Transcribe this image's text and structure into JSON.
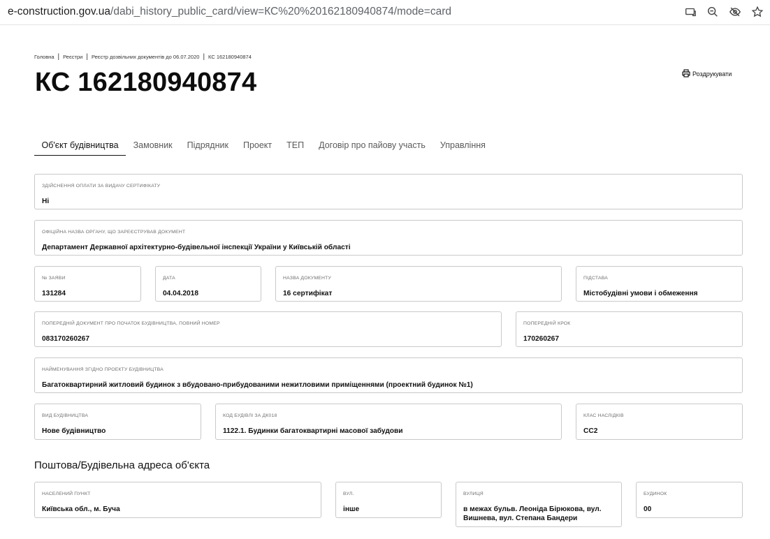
{
  "browser": {
    "url_host": "e-construction.gov.ua",
    "url_path": "/dabi_history_public_card/view=КС%20%20162180940874/mode=card",
    "icons": [
      "cast-icon",
      "zoom-icon",
      "eye-off-icon",
      "star-icon"
    ]
  },
  "breadcrumb": [
    "Головна",
    "Реєстри",
    "Реєстр дозвільних документів до 06.07.2020",
    "КС 162180940874"
  ],
  "title": "КС 162180940874",
  "print_label": "Роздрукувати",
  "tabs": [
    "Об'єкт будівництва",
    "Замовник",
    "Підрядник",
    "Проект",
    "ТЕП",
    "Договір про пайову участь",
    "Управління"
  ],
  "fields": {
    "payment": {
      "label": "Здійснення оплати за видачу сертифікату",
      "value": "Ні"
    },
    "authority": {
      "label": "Офіційна назва органу, що зареєстрував документ",
      "value": "Департамент Державної архітектурно-будівельної інспекції України у Київській області"
    },
    "app_no": {
      "label": "№ заяви",
      "value": "131284"
    },
    "date": {
      "label": "Дата",
      "value": "04.04.2018"
    },
    "doc_name": {
      "label": "Назва документу",
      "value": "16 сертифікат"
    },
    "basis": {
      "label": "Підстава",
      "value": "Містобудівні умови і обмеження"
    },
    "prev_doc": {
      "label": "Попередній документ про початок будівництва, повний номер",
      "value": "083170260267"
    },
    "prev_step": {
      "label": "Попередній крок",
      "value": "170260267"
    },
    "project_name": {
      "label": "Найменування згідно проекту будівництва",
      "value": "Багатоквартирний житловий будинок з вбудовано-прибудованими нежитловими приміщеннями (проектний будинок №1)"
    },
    "build_type": {
      "label": "Вид будівництва",
      "value": "Нове будівництво"
    },
    "building_code": {
      "label": "Код будівлі за ДК018",
      "value": "1122.1. Будинки багатоквартирні масової забудови"
    },
    "consequence_class": {
      "label": "Клас наслідків",
      "value": "СС2"
    }
  },
  "address_title": "Поштова/Будівельна адреса об'єкта",
  "address": {
    "locality": {
      "label": "Населений пункт",
      "value": "Київська обл., м. Буча"
    },
    "street_type": {
      "label": "Вул.",
      "value": "інше"
    },
    "street": {
      "label": "Вулиця",
      "value": "в межах бульв. Леоніда Бірюкова, вул. Вишнева, вул. Степана Бандери"
    },
    "house": {
      "label": "Будинок",
      "value": "00"
    }
  }
}
